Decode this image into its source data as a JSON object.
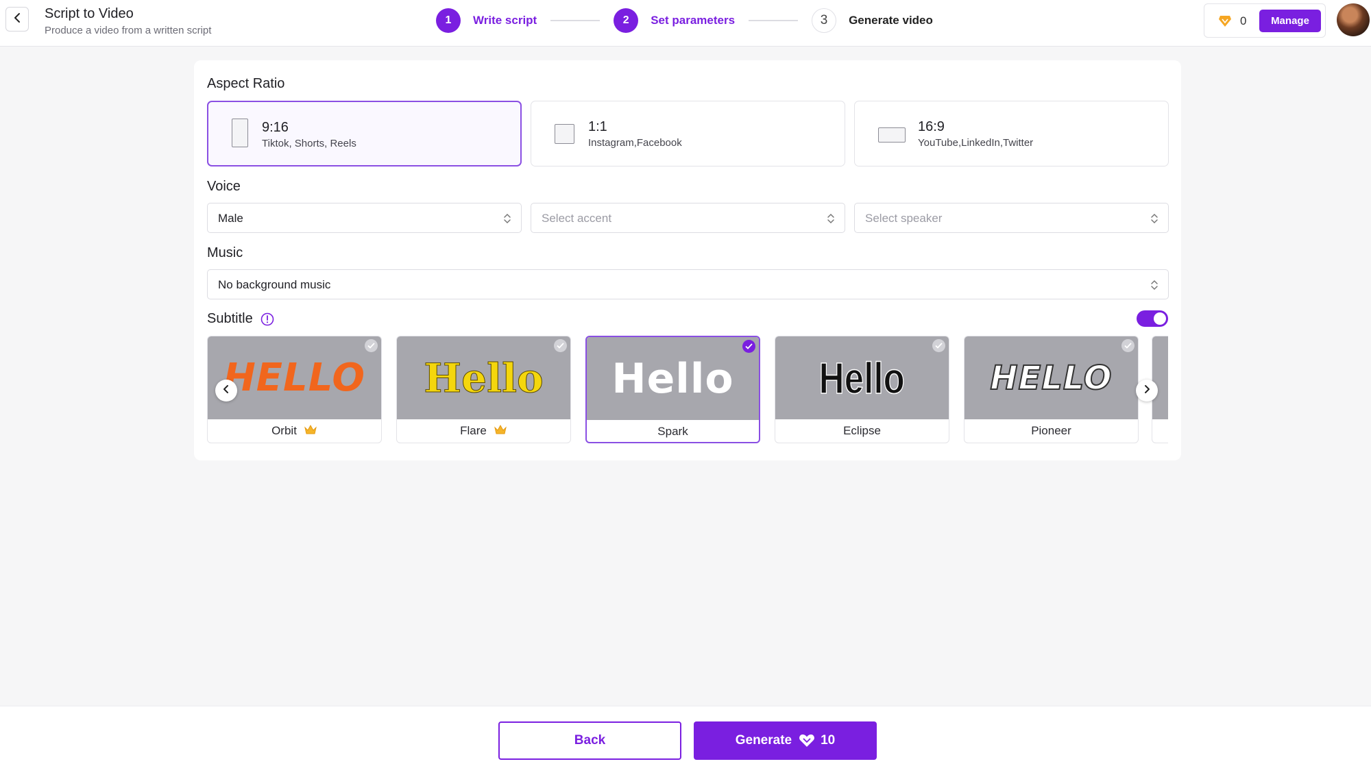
{
  "header": {
    "title": "Script to Video",
    "subtitle": "Produce a video from a written script",
    "steps": [
      {
        "number": "1",
        "label": "Write script",
        "state": "done"
      },
      {
        "number": "2",
        "label": "Set parameters",
        "state": "current"
      },
      {
        "number": "3",
        "label": "Generate video",
        "state": "pending"
      }
    ],
    "credits": "0",
    "manage_label": "Manage"
  },
  "aspect_ratio": {
    "label": "Aspect Ratio",
    "options": [
      {
        "value": "9:16",
        "desc": "Tiktok, Shorts, Reels",
        "selected": true
      },
      {
        "value": "1:1",
        "desc": "Instagram,Facebook",
        "selected": false
      },
      {
        "value": "16:9",
        "desc": "YouTube,LinkedIn,Twitter",
        "selected": false
      }
    ]
  },
  "voice": {
    "label": "Voice",
    "gender_value": "Male",
    "accent_placeholder": "Select accent",
    "speaker_placeholder": "Select speaker"
  },
  "music": {
    "label": "Music",
    "value": "No background music"
  },
  "subtitle": {
    "label": "Subtitle",
    "enabled": true,
    "preview_text": "Hello",
    "styles": [
      {
        "name": "Orbit",
        "preview": "HELLO",
        "premium": true,
        "selected": false
      },
      {
        "name": "Flare",
        "preview": "Hello",
        "premium": true,
        "selected": false
      },
      {
        "name": "Spark",
        "preview": "Hello",
        "premium": false,
        "selected": true
      },
      {
        "name": "Eclipse",
        "preview": "Hello",
        "premium": false,
        "selected": false
      },
      {
        "name": "Pioneer",
        "preview": "HELLO",
        "premium": false,
        "selected": false
      }
    ]
  },
  "footer": {
    "back_label": "Back",
    "generate_label": "Generate",
    "generate_cost": "10"
  },
  "colors": {
    "accent": "#7a1fe0",
    "credit_gem": "#f5a623"
  }
}
